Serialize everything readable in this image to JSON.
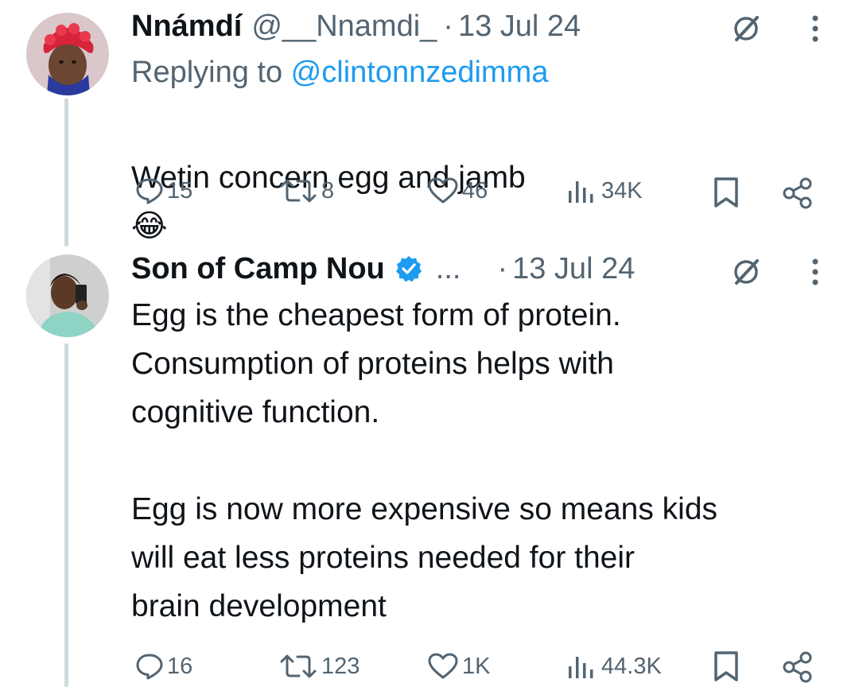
{
  "tweets": [
    {
      "author_name": "Nnámdí",
      "handle": "@__Nnamdi_",
      "separator": "·",
      "date": "13 Jul 24",
      "replying_prefix": "Replying to ",
      "replying_to": "@clintonnzedimma",
      "text": "Wetin concern egg and jamb",
      "emoji": "😂",
      "avatar_icon": "avatar-red-hat",
      "stats": {
        "replies": "15",
        "reposts": "8",
        "likes": "46",
        "views": "34K"
      }
    },
    {
      "author_name": "Son of Camp Nou",
      "verified": true,
      "truncated_handle": "...",
      "separator": "·",
      "date": "13 Jul 24",
      "text": "Egg is the cheapest form of protein.\nConsumption of proteins helps with\ncognitive function.\n\nEgg is now more expensive so means kids\nwill eat less proteins needed for their\nbrain development",
      "avatar_icon": "avatar-mirror-selfie",
      "stats": {
        "replies": "16",
        "reposts": "123",
        "likes": "1K",
        "views": "44.3K"
      }
    }
  ],
  "colors": {
    "text": "#0f1419",
    "muted": "#536471",
    "link": "#1d9bf0",
    "verified": "#1d9bf0",
    "thread_line": "#cfd9de"
  }
}
